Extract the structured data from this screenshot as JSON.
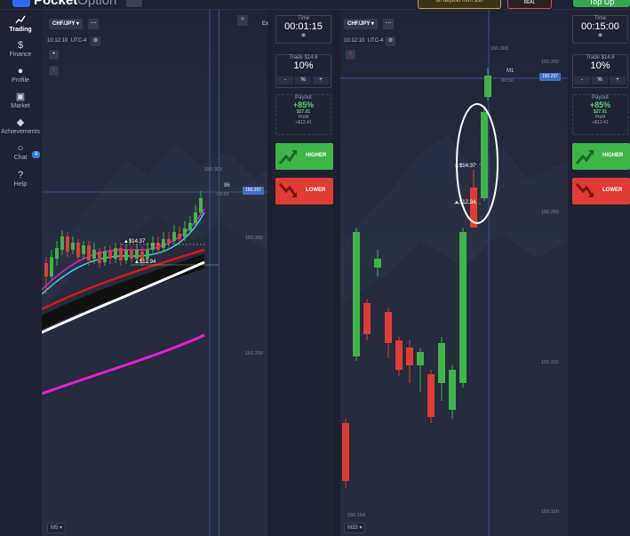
{
  "topbar": {
    "logo_bold": "Pocket",
    "logo_light": "Option",
    "promo_text": "on deposit from $50",
    "account_label": "REAL",
    "topup_label": "Top Up"
  },
  "sidebar": {
    "items": [
      {
        "label": "Trading",
        "icon": "trading-chart-icon"
      },
      {
        "label": "Finance",
        "icon": "dollar-icon"
      },
      {
        "label": "Profile",
        "icon": "user-icon"
      },
      {
        "label": "Market",
        "icon": "cart-icon"
      },
      {
        "label": "Achievements",
        "icon": "diamond-icon"
      },
      {
        "label": "Chat",
        "icon": "chat-icon"
      },
      {
        "label": "Help",
        "icon": "help-icon"
      }
    ],
    "chat_badge": "4"
  },
  "chart1": {
    "pair": "CHF/JPY",
    "time": "10:12:10",
    "timezone": "UTC-4",
    "indicator_label": "86",
    "indicator_sub": "00:50",
    "price_current": "150.297",
    "price_top": "150.303",
    "scale_labels": [
      "150.300",
      "150.200"
    ],
    "trade1": "$14.37",
    "trade2": "$12.94",
    "timeframe": "M5",
    "expand_label": "Ex"
  },
  "chart2": {
    "pair": "CHF/JPY",
    "time": "10:12:10",
    "timezone": "UTC-4",
    "indicator_label": "M1",
    "indicator_sub": "00:50",
    "price_current": "150.297",
    "price_top": "150.303",
    "scale_labels": [
      "150.300",
      "150.250",
      "150.200",
      "150.150"
    ],
    "bottom_price": "150.154",
    "trade1": "$14.37",
    "trade2": "$12.94",
    "timeframe": "M33"
  },
  "panel1": {
    "time_label": "Time",
    "time_value": "00:01:15",
    "trade_label": "Trade $14.6",
    "trade_value": "10%",
    "minus": "-",
    "pct": "%",
    "plus": "+",
    "payout_label": "Payout",
    "payout_pct": "+85%",
    "payout_amount": "$27.01",
    "profit_label": "Profit",
    "profit_value": "+$12.41",
    "higher": "HIGHER",
    "lower": "LOWER"
  },
  "panel2": {
    "time_label": "Time",
    "time_value": "00:15:00",
    "trade_label": "Trade $14.6",
    "trade_value": "10%",
    "minus": "-",
    "pct": "%",
    "plus": "+",
    "payout_label": "Payout",
    "payout_pct": "+85%",
    "payout_amount": "$27.01",
    "profit_label": "Profit",
    "profit_value": "+$12.41",
    "higher": "HIGHER",
    "lower": "LOWER"
  },
  "colors": {
    "up": "#3eb548",
    "down": "#e03c34",
    "accent": "#3f6fc4",
    "ma_magenta": "#e21fd0",
    "ma_cyan": "#34d6e6",
    "ma_red": "#d8171b",
    "ma_white": "#ffffff",
    "annotation": "#ffffff"
  }
}
